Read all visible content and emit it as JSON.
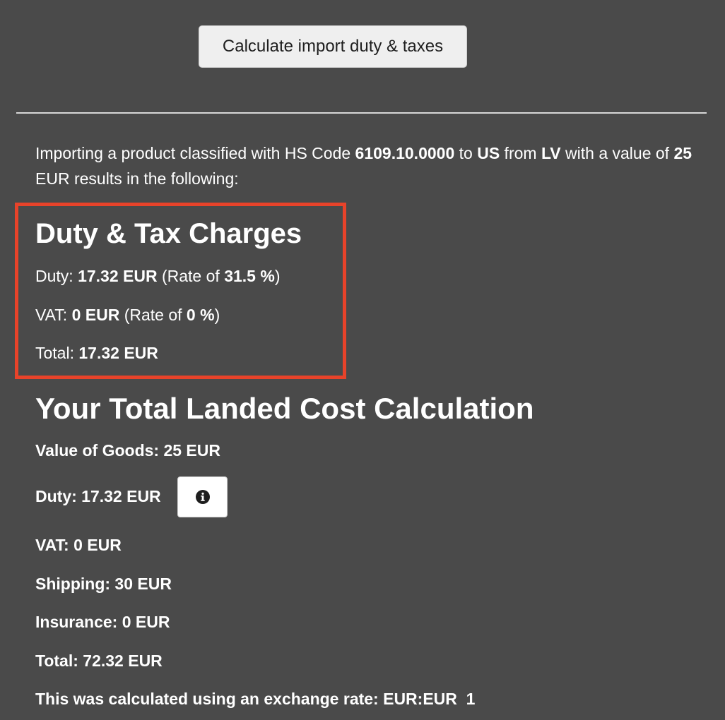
{
  "calculate_button": {
    "label": "Calculate import duty & taxes"
  },
  "summary": {
    "part1": "Importing a product classified with HS Code ",
    "hs_code": "6109.10.0000",
    "part2": " to ",
    "to_country": "US",
    "part3": " from ",
    "from_country": "LV",
    "part4": " with a value of ",
    "value": "25",
    "part5": " EUR results in the following:"
  },
  "duty_tax": {
    "title": "Duty & Tax Charges",
    "duty_label": "Duty: ",
    "duty_value": "17.32 EUR",
    "duty_rate_prefix": " (Rate of ",
    "duty_rate": "31.5 %",
    "rate_suffix": ")",
    "vat_label": "VAT: ",
    "vat_value": "0 EUR",
    "vat_rate_prefix": " (Rate of ",
    "vat_rate": "0 %",
    "vat_rate_suffix": ")",
    "total_label": "Total: ",
    "total_value": "17.32 EUR"
  },
  "landed_cost": {
    "title": "Your Total Landed Cost Calculation",
    "value_of_goods": "Value of Goods: 25 EUR",
    "duty": "Duty: 17.32 EUR",
    "vat": "VAT: 0 EUR",
    "shipping": "Shipping: 30 EUR",
    "insurance": "Insurance: 0 EUR",
    "total": "Total: 72.32 EUR",
    "exchange_rate": "This was calculated using an exchange rate: EUR:EUR  1"
  },
  "icons": {
    "info": "info-circle-icon"
  },
  "colors": {
    "background": "#4a4a4a",
    "highlight_border": "#e8432a",
    "text": "#ffffff"
  }
}
